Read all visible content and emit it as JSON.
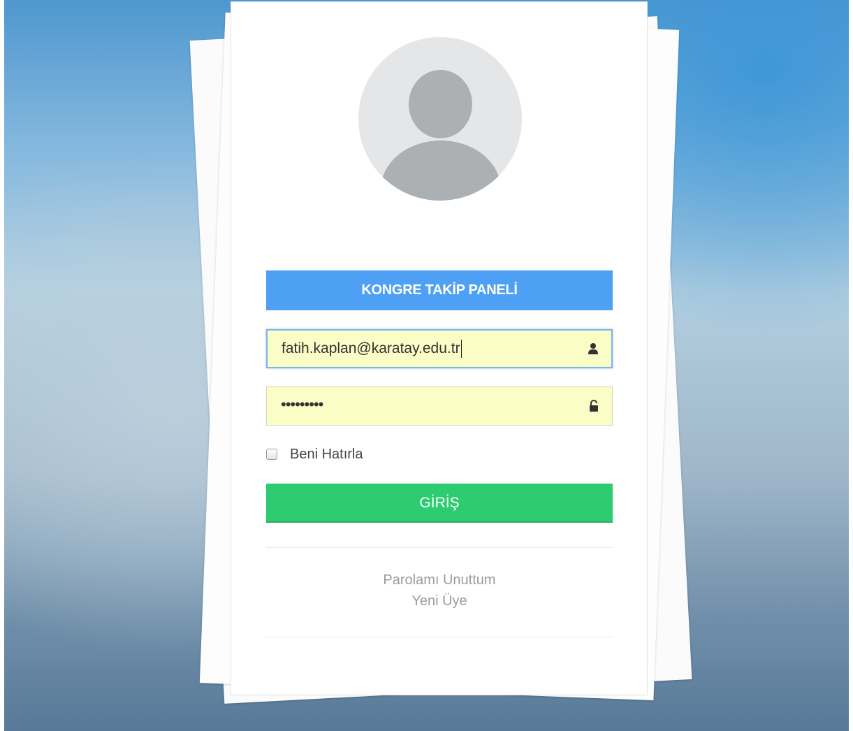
{
  "panel": {
    "title": "KONGRE TAKİP PANELİ"
  },
  "form": {
    "email_value": "fatih.kaplan@karatay.edu.tr",
    "password_masked": "•••••••••",
    "remember_label": "Beni Hatırla",
    "remember_checked": false,
    "submit_label": "GİRİŞ"
  },
  "links": {
    "forgot_password": "Parolamı Unuttum",
    "new_member": "Yeni Üye"
  },
  "colors": {
    "title_bar": "#4ea0f5",
    "submit_button": "#2ecc71",
    "autofill_field": "#fbfdc6"
  },
  "icons": {
    "email_field": "user-icon",
    "password_field": "unlock-icon",
    "avatar": "avatar-placeholder-icon"
  }
}
